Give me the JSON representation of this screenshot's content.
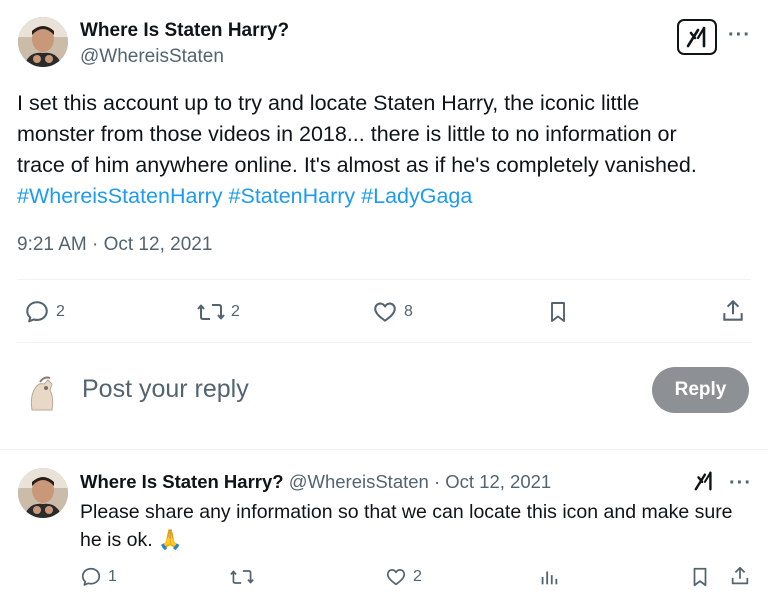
{
  "tweet": {
    "author_name": "Where Is Staten Harry?",
    "author_handle": "@WhereisStaten",
    "text_lines": [
      "I set this account up to try and locate Staten Harry, the iconic little",
      "monster from those videos in 2018... there is little to no information or",
      "trace of him anywhere online. It's almost as if he's completely vanished."
    ],
    "hashtags": [
      "#WhereisStatenHarry",
      "#StatenHarry",
      "#LadyGaga"
    ],
    "timestamp": "9:21 AM · Oct 12, 2021",
    "actions": {
      "replies": "2",
      "reposts": "2",
      "likes": "8"
    }
  },
  "composer": {
    "placeholder": "Post your reply",
    "button_label": "Reply"
  },
  "reply": {
    "author_name": "Where Is Staten Harry?",
    "author_handle": "@WhereisStaten",
    "date": "· Oct 12, 2021",
    "text_lines": [
      "Please share any information so that we can locate this icon and make sure",
      "he is ok. 🙏"
    ],
    "actions": {
      "replies": "1",
      "likes": "2"
    }
  },
  "icons": {
    "more": "more-icon",
    "grok": "grok-icon",
    "reply": "comment-icon",
    "repost": "repost-icon",
    "like": "heart-icon",
    "bookmark": "bookmark-icon",
    "share": "share-icon",
    "views": "views-icon"
  },
  "colors": {
    "text": "#0f1419",
    "secondary": "#536471",
    "hashtag": "#1d9bf0",
    "reply_button": "#8d9094",
    "divider": "#eff3f4"
  }
}
